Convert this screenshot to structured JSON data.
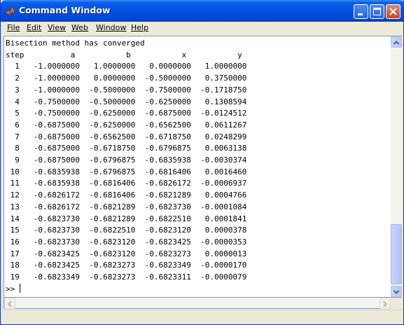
{
  "window": {
    "title": "Command Window",
    "colors": {
      "titlebar": "#0451e1",
      "close_button": "#c9441f",
      "client_bg": "#ffffff"
    }
  },
  "menu": [
    {
      "label": "File"
    },
    {
      "label": "Edit"
    },
    {
      "label": "View"
    },
    {
      "label": "Web"
    },
    {
      "label": "Window"
    },
    {
      "label": "Help"
    }
  ],
  "console": {
    "message": "Bisection method has converged",
    "header": "step          a           b           x           y",
    "rows": [
      "  1   -1.0000000   1.0000000   0.0000000   1.0000000",
      "  2   -1.0000000   0.0000000  -0.5000000   0.3750000",
      "  3   -1.0000000  -0.5000000  -0.7500000  -0.1718750",
      "  4   -0.7500000  -0.5000000  -0.6250000   0.1308594",
      "  5   -0.7500000  -0.6250000  -0.6875000  -0.0124512",
      "  6   -0.6875000  -0.6250000  -0.6562500   0.0611267",
      "  7   -0.6875000  -0.6562500  -0.6718750   0.0248299",
      "  8   -0.6875000  -0.6718750  -0.6796875   0.0063138",
      "  9   -0.6875000  -0.6796875  -0.6835938  -0.0030374",
      " 10   -0.6835938  -0.6796875  -0.6816406   0.0016460",
      " 11   -0.6835938  -0.6816406  -0.6826172  -0.0006937",
      " 12   -0.6826172  -0.6816406  -0.6821289   0.0004766",
      " 13   -0.6826172  -0.6821289  -0.6823730  -0.0001084",
      " 14   -0.6823730  -0.6821289  -0.6822510   0.0001841",
      " 15   -0.6823730  -0.6822510  -0.6823120   0.0000378",
      " 16   -0.6823730  -0.6823120  -0.6823425  -0.0000353",
      " 17   -0.6823425  -0.6823120  -0.6823273   0.0000013",
      " 18   -0.6823425  -0.6823273  -0.6823349  -0.0000170",
      " 19   -0.6823349  -0.6823273  -0.6823311  -0.0000079"
    ],
    "prompt": ">> "
  },
  "icons": {
    "app": "matlab-logo-icon",
    "minimize": "minimize-icon",
    "maximize": "maximize-icon",
    "close": "close-icon",
    "scroll_up": "arrow-up-icon",
    "scroll_down": "arrow-down-icon",
    "scroll_left": "arrow-left-icon",
    "scroll_right": "arrow-right-icon"
  }
}
